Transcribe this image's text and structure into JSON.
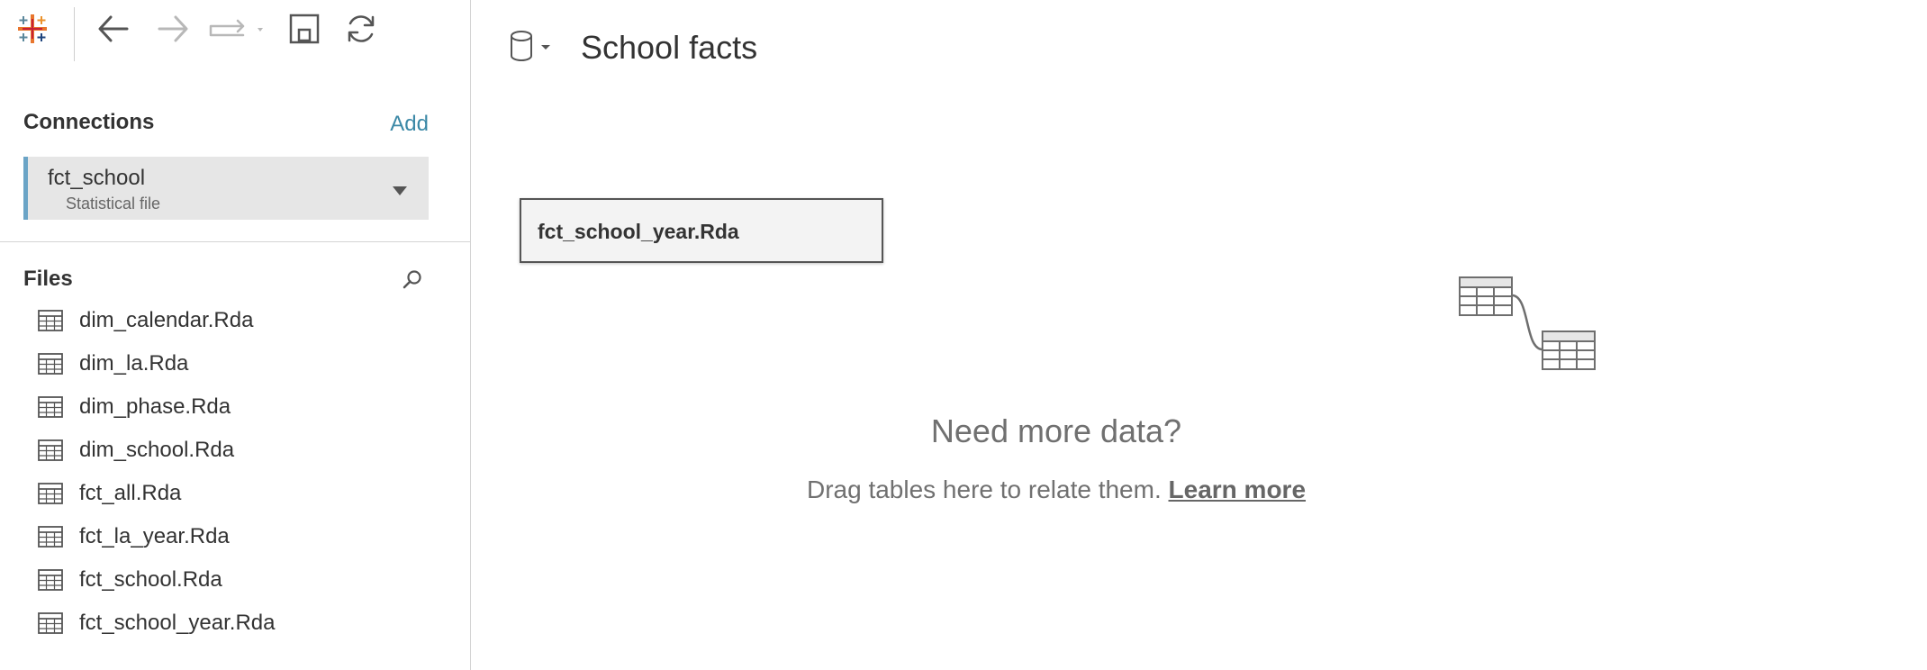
{
  "toolbar": {
    "logo_icon": "tableau-logo-icon",
    "back_icon": "arrow-left-icon",
    "forward_icon": "arrow-right-icon",
    "redo_icon": "redo-dropdown-icon",
    "save_icon": "save-icon",
    "refresh_icon": "refresh-icon"
  },
  "connections": {
    "header": "Connections",
    "add_label": "Add",
    "items": [
      {
        "name": "fct_school",
        "type": "Statistical file"
      }
    ]
  },
  "files": {
    "header": "Files",
    "search_icon": "search-icon",
    "items": [
      {
        "name": "dim_calendar.Rda"
      },
      {
        "name": "dim_la.Rda"
      },
      {
        "name": "dim_phase.Rda"
      },
      {
        "name": "dim_school.Rda"
      },
      {
        "name": "fct_all.Rda"
      },
      {
        "name": "fct_la_year.Rda"
      },
      {
        "name": "fct_school.Rda"
      },
      {
        "name": "fct_school_year.Rda"
      }
    ]
  },
  "canvas": {
    "datasource_title": "School facts",
    "table_box_label": "fct_school_year.Rda",
    "need_more_title": "Need more data?",
    "drag_hint": "Drag tables here to relate them.",
    "learn_more": "Learn more"
  },
  "colors": {
    "accent": "#3b88a6",
    "connection_bar": "#6ba4c6",
    "connection_bg": "#e6e6e6",
    "muted_text": "#707070"
  }
}
